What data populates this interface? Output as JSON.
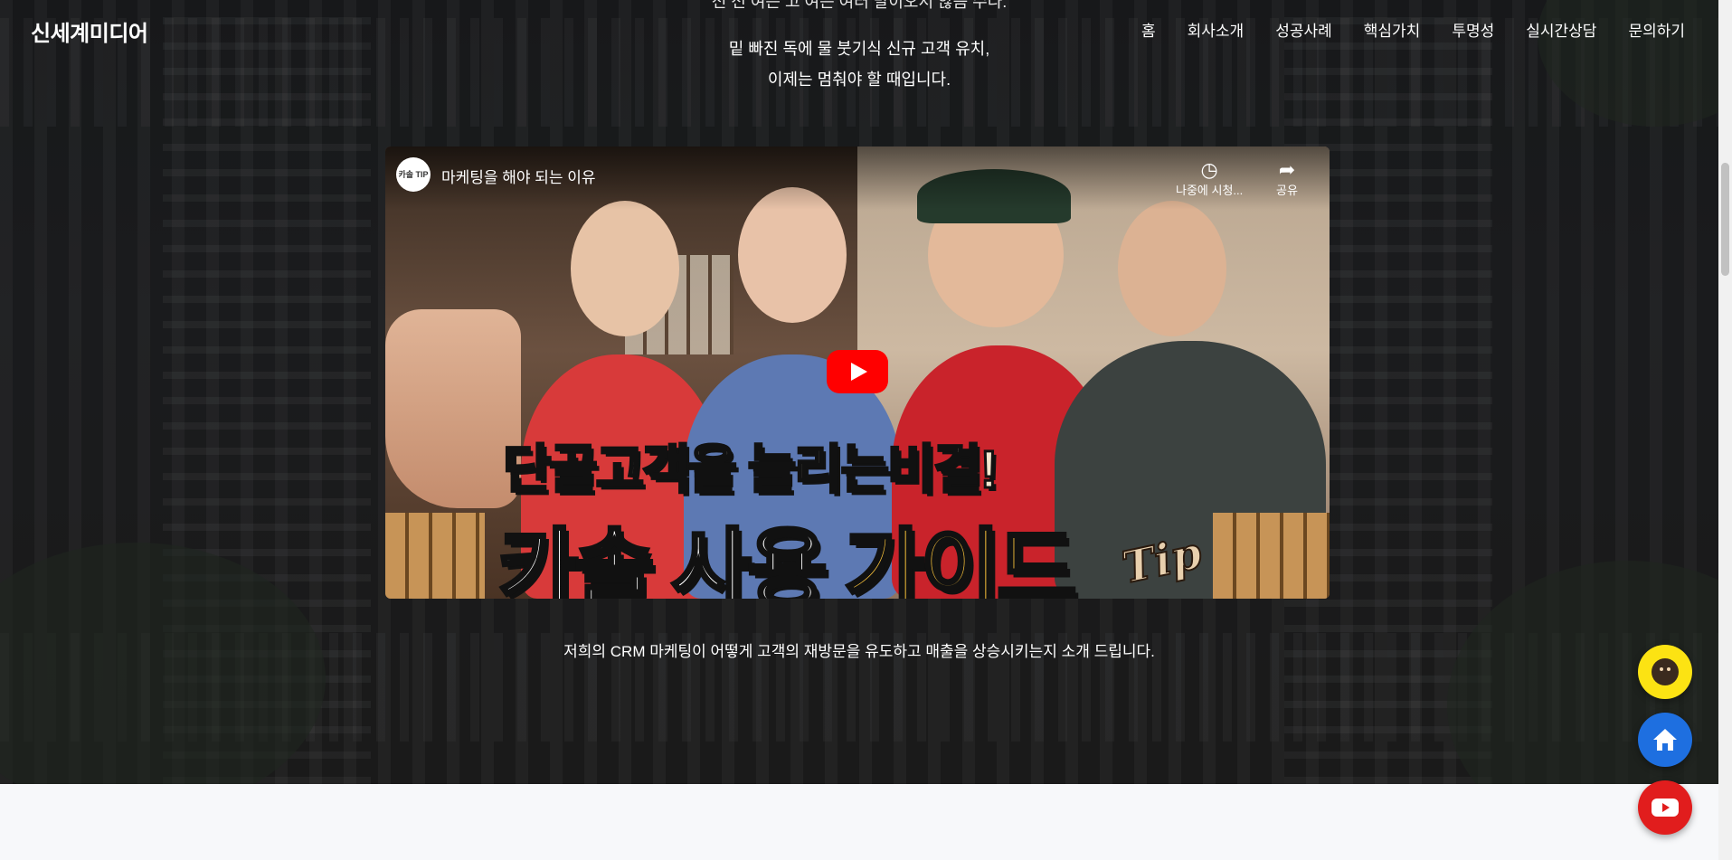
{
  "header": {
    "brand": "신세계미디어",
    "nav": [
      "홈",
      "회사소개",
      "성공사례",
      "핵심가치",
      "투명성",
      "실시간상담",
      "문의하기"
    ]
  },
  "intro": {
    "cut_line": "전 전 여는 고 여는 여러 말이오서 않음 수다.",
    "line1": "밑 빠진 독에 물 붓기식 신규 고객 유치,",
    "line2": "이제는 멈춰야 할 때입니다."
  },
  "video": {
    "channel_badge": "카솔 TIP",
    "title": "마케팅을 해야 되는 이유",
    "watch_later": "나중에 시청...",
    "share": "공유",
    "thumb_line1": "단골고객을 늘리는비결!",
    "thumb_line2_a": "카솔 사용 ",
    "thumb_line2_b": "가이드",
    "thumb_tip": "Tip"
  },
  "caption": "저희의 CRM 마케팅이 어떻게 고객의 재방문을 유도하고 매출을 상승시키는지 소개 드립니다.",
  "icons": {
    "watch_later": "clock-icon",
    "share": "share-arrow-icon",
    "play": "youtube-play-icon",
    "kakao": "kakao-chat-icon",
    "home": "home-icon",
    "youtube": "youtube-icon"
  },
  "colors": {
    "kakao": "#fce313",
    "home": "#1e6fe0",
    "youtube": "#e11d1d",
    "thumb_highlight": "#fcc53b"
  }
}
